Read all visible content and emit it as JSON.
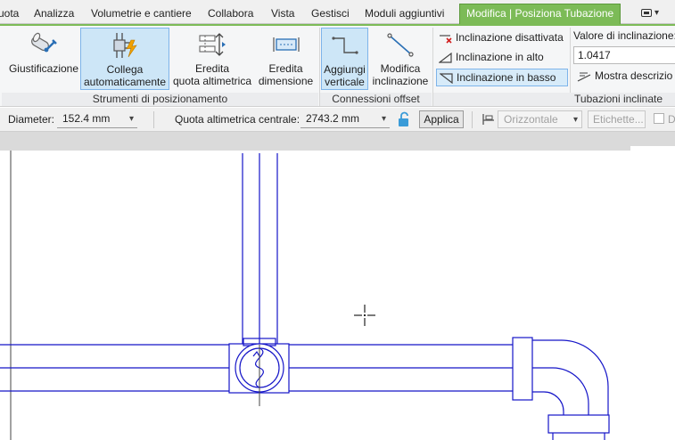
{
  "tabs": [
    {
      "label": "uota",
      "active": false
    },
    {
      "label": "Analizza",
      "active": false
    },
    {
      "label": "Volumetrie e cantiere",
      "active": false
    },
    {
      "label": "Collabora",
      "active": false
    },
    {
      "label": "Vista",
      "active": false
    },
    {
      "label": "Gestisci",
      "active": false
    },
    {
      "label": "Moduli aggiuntivi",
      "active": false
    },
    {
      "label": "Modifica | Posiziona Tubazione",
      "active": true
    }
  ],
  "ribbon": {
    "buttons": [
      {
        "label": "Giustificazione",
        "icon": "justification-icon",
        "selected": false
      },
      {
        "label": "Collega\nautomaticamente",
        "icon": "auto-connect-icon",
        "selected": true
      },
      {
        "label": "Eredita\nquota altimetrica",
        "icon": "inherit-elevation-icon",
        "selected": false
      },
      {
        "label": "Eredita\ndimensione",
        "icon": "inherit-size-icon",
        "selected": false
      },
      {
        "label": "Aggiungi\nverticale",
        "icon": "add-vertical-icon",
        "selected": true
      },
      {
        "label": "Modifica\ninclinazione",
        "icon": "change-slope-icon",
        "selected": false
      }
    ],
    "panels": {
      "placement_tools": "Strumenti di posizionamento",
      "offset_connections": "Connessioni offset",
      "sloped_piping": "Tubazioni inclinate"
    },
    "slope_options": [
      {
        "label": "Inclinazione disattivata",
        "icon": "slope-off-icon",
        "selected": false
      },
      {
        "label": "Inclinazione in alto",
        "icon": "slope-up-icon",
        "selected": false
      },
      {
        "label": "Inclinazione in basso",
        "icon": "slope-down-icon",
        "selected": true
      }
    ],
    "slope_value_label": "Valore di inclinazione:",
    "slope_value": "1.0417",
    "show_description": "Mostra descrizio"
  },
  "options_bar": {
    "diameter_label": "Diameter:",
    "diameter_value": "152.4 mm",
    "elevation_label": "Quota altimetrica centrale:",
    "elevation_value": "2743.2 mm",
    "lock_icon": "unlock-icon",
    "apply": "Applica",
    "horizontal_icon": "horizontal-align-icon",
    "horizontal": "Orizzontale",
    "labels": "Etichette...",
    "checkbox_label": "Di"
  },
  "canvas": {
    "cursor_icon": "crosshair-cursor-icon"
  },
  "colors": {
    "accent": "#7cbb57",
    "selection": "#cde6f7",
    "pipe_line": "#1515c8",
    "ribbon_bg": "#f5f6f7"
  }
}
